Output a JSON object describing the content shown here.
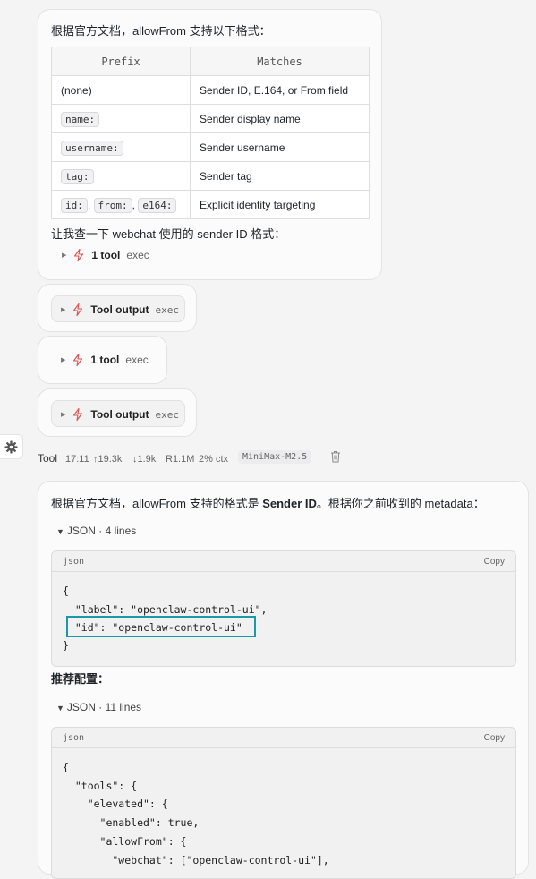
{
  "msg1": {
    "intro": "根据官方文档，allowFrom 支持以下格式：",
    "table": {
      "headers": [
        "Prefix",
        "Matches"
      ],
      "rows": [
        {
          "prefix": "(none)",
          "matches": "Sender ID, E.164, or From field"
        },
        {
          "prefix": "name:",
          "matches": "Sender display name"
        },
        {
          "prefix": "username:",
          "matches": "Sender username"
        },
        {
          "prefix": "tag:",
          "matches": "Sender tag"
        },
        {
          "prefix_parts": [
            "id:",
            "from:",
            "e164:"
          ],
          "matches": "Explicit identity targeting"
        }
      ]
    },
    "followup": "让我查一下 webchat 使用的 sender ID 格式：",
    "tool": {
      "label": "1 tool",
      "sub": "exec"
    }
  },
  "tool_cards": [
    {
      "label": "Tool output",
      "sub": "exec"
    },
    {
      "label": "1 tool",
      "sub": "exec"
    },
    {
      "label": "Tool output",
      "sub": "exec"
    }
  ],
  "meta": {
    "sender": "Tool",
    "time": "17:11",
    "up": "↑19.3k",
    "down": "↓1.9k",
    "r": "R1.1M",
    "ctx": "2% ctx",
    "model": "MiniMax-M2.5"
  },
  "msg2": {
    "intro_pre": "根据官方文档，allowFrom 支持的格式是 ",
    "intro_bold": "Sender ID",
    "intro_post": "。根据你之前收到的 metadata：",
    "json1": {
      "summary": "JSON · 4 lines",
      "lang": "json",
      "copy": "Copy",
      "lines": [
        "{",
        "  \"label\": \"openclaw-control-ui\",",
        "  \"id\": \"openclaw-control-ui\"",
        "}"
      ]
    },
    "recommend": "推荐配置：",
    "json2": {
      "summary": "JSON · 11 lines",
      "lang": "json",
      "copy": "Copy",
      "lines": [
        "{",
        "  \"tools\": {",
        "    \"elevated\": {",
        "      \"enabled\": true,",
        "      \"allowFrom\": {",
        "        \"webchat\": [\"openclaw-control-ui\"],"
      ]
    }
  },
  "colors": {
    "highlight": "#1a9aa8",
    "bolt": "#d9534f"
  }
}
